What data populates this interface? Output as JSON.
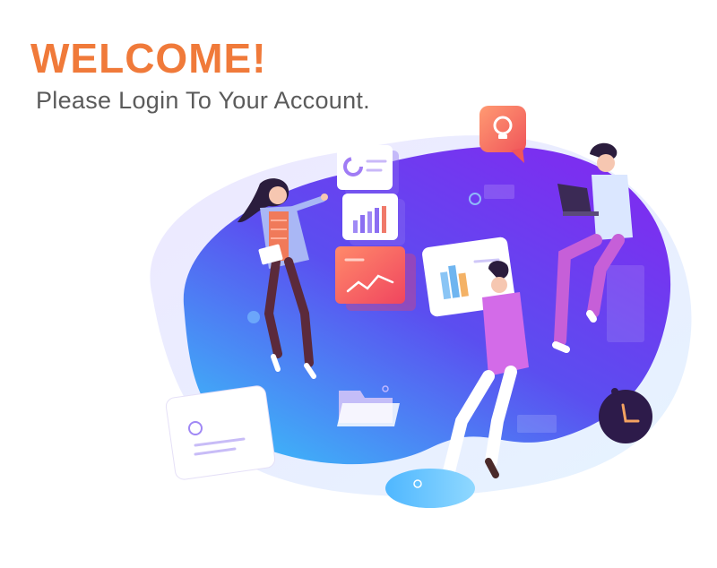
{
  "header": {
    "title": "WELCOME!",
    "subtitle": "Please Login To Your Account."
  },
  "illustration": {
    "icons": [
      "lightbulb-icon",
      "clock-icon",
      "folder-icon",
      "user-card-icon",
      "bar-chart-icon",
      "donut-chart-icon",
      "line-chart-icon",
      "laptop-icon"
    ]
  },
  "colors": {
    "accent": "#f07a3a",
    "subtitle": "#5b5b5b",
    "blob_start": "#8e3cf0",
    "blob_end": "#3aa0f5"
  }
}
